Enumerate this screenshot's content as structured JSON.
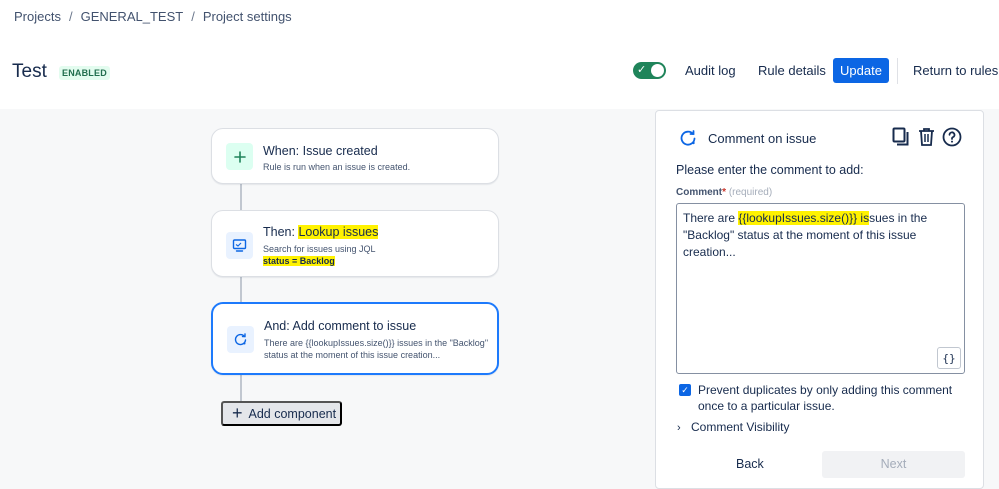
{
  "breadcrumb": {
    "items": [
      "Projects",
      "GENERAL_TEST",
      "Project settings"
    ],
    "separator": "/"
  },
  "header": {
    "title": "Test",
    "status_badge": "ENABLED",
    "toggle_enabled": true,
    "audit_log": "Audit log",
    "rule_details": "Rule details",
    "update": "Update",
    "return_to_rules": "Return to rules"
  },
  "colors": {
    "primary": "#0c66e4",
    "selected_border": "#1d7afc",
    "toggle_on": "#1f845a",
    "highlight": "#fff200",
    "trigger_icon_bg": "#dcfff1",
    "action_icon_bg": "#e9f2ff"
  },
  "flow": {
    "trigger": {
      "heading": "When: Issue created",
      "description": "Rule is run when an issue is created.",
      "icon": "plus-icon"
    },
    "lookup": {
      "heading_prefix": "Then: ",
      "heading_highlight": "Lookup issues",
      "description": "Search for issues using JQL",
      "jql": "status = Backlog",
      "icon": "monitor-icon"
    },
    "comment": {
      "heading": "And: Add comment to issue",
      "description_line1": "There are {{lookupIssues.size()}} issues in the \"Backlog\"",
      "description_line2": "status at the moment of this issue creation...",
      "icon": "comment-refresh-icon"
    },
    "add_component": "Add component"
  },
  "panel": {
    "title": "Comment on issue",
    "prompt": "Please enter the comment to add:",
    "field_label": "Comment",
    "required_mark": "*",
    "required_hint": "(required)",
    "comment_before": "There are ",
    "comment_highlight": "{{lookupIssues.size()}} is",
    "comment_after": "sues in the \"Backlog\" status at the moment of this issue creation...",
    "braces": "{}",
    "prevent_duplicates": "Prevent duplicates by only adding this comment once to a particular issue.",
    "prevent_duplicates_checked": true,
    "visibility": "Comment Visibility",
    "back": "Back",
    "next": "Next"
  }
}
